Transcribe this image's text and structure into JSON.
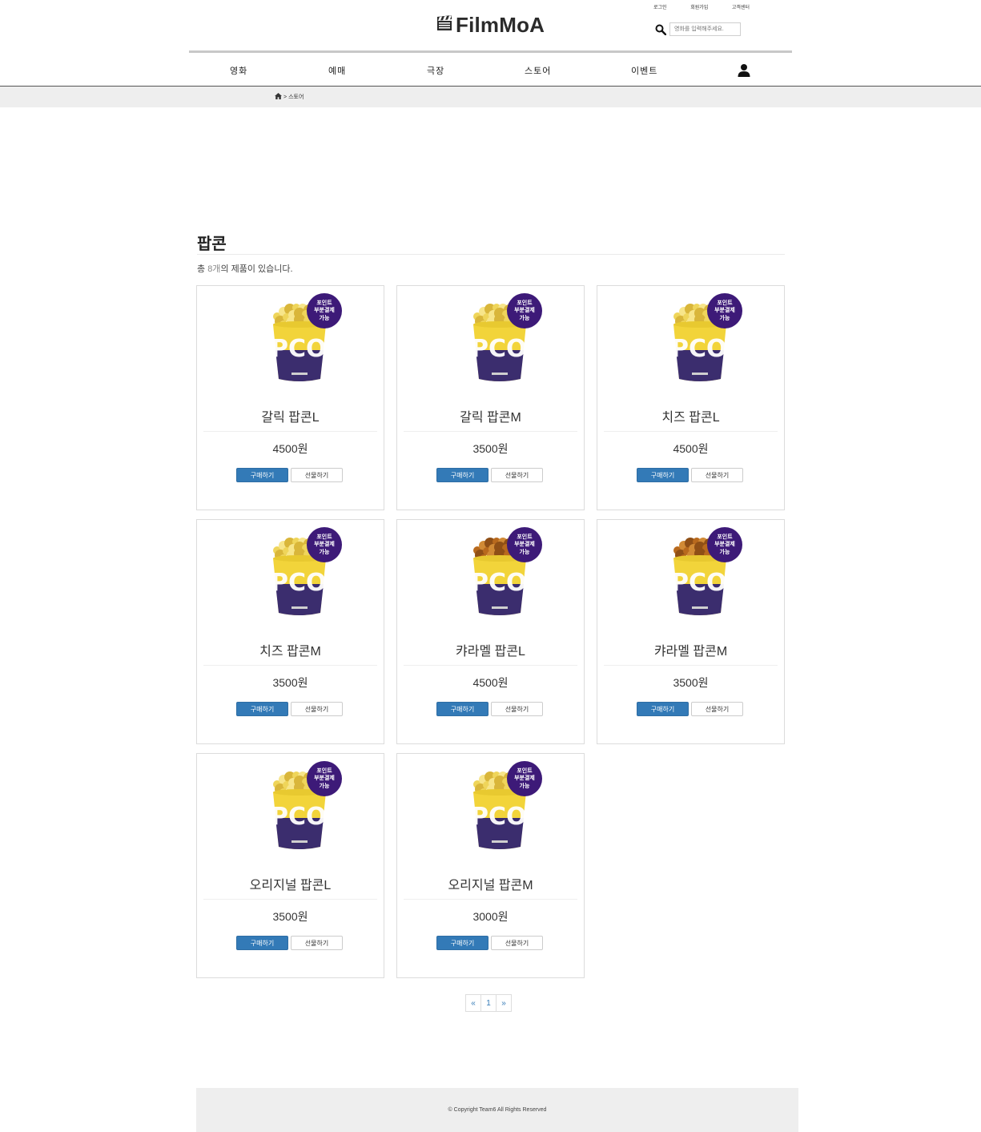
{
  "header": {
    "top_links": {
      "login": "로그인",
      "signup": "회원가입",
      "support": "고객센터"
    },
    "logo_text": "FilmMoA",
    "search_placeholder": "영화를 입력해주세요."
  },
  "nav": {
    "items": [
      {
        "label": "영화"
      },
      {
        "label": "예매"
      },
      {
        "label": "극장"
      },
      {
        "label": "스토어"
      },
      {
        "label": "이벤트"
      }
    ]
  },
  "breadcrumb": {
    "separator": ">",
    "current": "스토어"
  },
  "main": {
    "title": "팝콘",
    "count_prefix": "총 ",
    "count_value": "8개",
    "count_suffix": "의 제품이 있습니다.",
    "badge": {
      "line1": "포인트",
      "line2": "부분결제",
      "line3": "가능"
    },
    "buy_label": "구매하기",
    "gift_label": "선물하기",
    "products": [
      {
        "name": "갈릭 팝콘L",
        "price": "4500원",
        "flavor": "original"
      },
      {
        "name": "갈릭 팝콘M",
        "price": "3500원",
        "flavor": "original"
      },
      {
        "name": "치즈 팝콘L",
        "price": "4500원",
        "flavor": "original"
      },
      {
        "name": "치즈 팝콘M",
        "price": "3500원",
        "flavor": "original"
      },
      {
        "name": "캬라멜 팝콘L",
        "price": "4500원",
        "flavor": "caramel"
      },
      {
        "name": "캬라멜 팝콘M",
        "price": "3500원",
        "flavor": "caramel"
      },
      {
        "name": "오리지널 팝콘L",
        "price": "3500원",
        "flavor": "original"
      },
      {
        "name": "오리지널 팝콘M",
        "price": "3000원",
        "flavor": "original"
      }
    ]
  },
  "pagination": {
    "prev": "«",
    "current": "1",
    "next": "»"
  },
  "footer": {
    "text": "© Copyright Team6 All Rights Reserved"
  },
  "colors": {
    "primary_button": "#337ab7",
    "badge": "#3d1a78",
    "bucket_yellow": "#f2d43a",
    "bucket_purple": "#3b2d6e"
  }
}
